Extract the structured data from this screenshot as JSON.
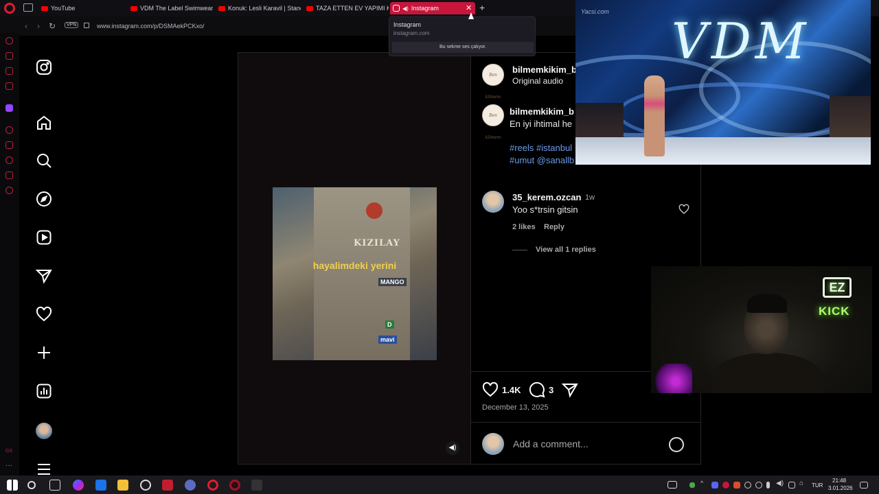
{
  "browser": {
    "tabs": [
      {
        "label": "YouTube"
      },
      {
        "label": "VDM The Label Swimwear"
      },
      {
        "label": "Konuk: Lesli Karavil | Stand"
      },
      {
        "label": "TAZA ETTEN EV YAPIMI KA"
      },
      {
        "label": "Instagram",
        "active": true
      }
    ],
    "url": "www.instagram.com/p/DSMAekPCKxo/",
    "vpn_label": "VPN",
    "tooltip": {
      "title": "Instagram",
      "url": "instagram.com",
      "audio_text": "Bu sekme ses çalıyor."
    }
  },
  "instagram_nav": {
    "items": [
      "instagram-logo",
      "home",
      "search",
      "explore",
      "reels",
      "messages",
      "notifications",
      "create",
      "dashboard",
      "profile",
      "more"
    ]
  },
  "post": {
    "header": {
      "username": "bilmemkikim_b",
      "audio": "Original audio",
      "avatar_text": "Ben kilmem"
    },
    "caption": {
      "username": "bilmemkikim_b",
      "text": "En iyi ihtimal he",
      "hashtags_line1": "#reels #istanbul",
      "hashtags_line2": "#umut @sanallb"
    },
    "comment": {
      "username": "35_kerem.ozcan",
      "time": "1w",
      "text": "Yoo s*trsin gitsin",
      "likes": "2 likes",
      "reply_label": "Reply",
      "view_replies": "View all 1 replies"
    },
    "video": {
      "overlay_text": "hayalimdeki yerini",
      "building_name": "KIZILAY",
      "signs": [
        "MANGO",
        "mavi",
        "D"
      ]
    },
    "actions": {
      "likes": "1.4K",
      "comments": "3"
    },
    "date": "December 13, 2025",
    "add_comment_placeholder": "Add a comment..."
  },
  "pip_video": {
    "logo": "VDM",
    "watermark": "Yacsi.com"
  },
  "webcam": {
    "sign_ez": "EZ",
    "sign_kick": "KICK"
  },
  "taskbar": {
    "language": "TUR",
    "time": "21:48",
    "date": "3.01.2026"
  }
}
